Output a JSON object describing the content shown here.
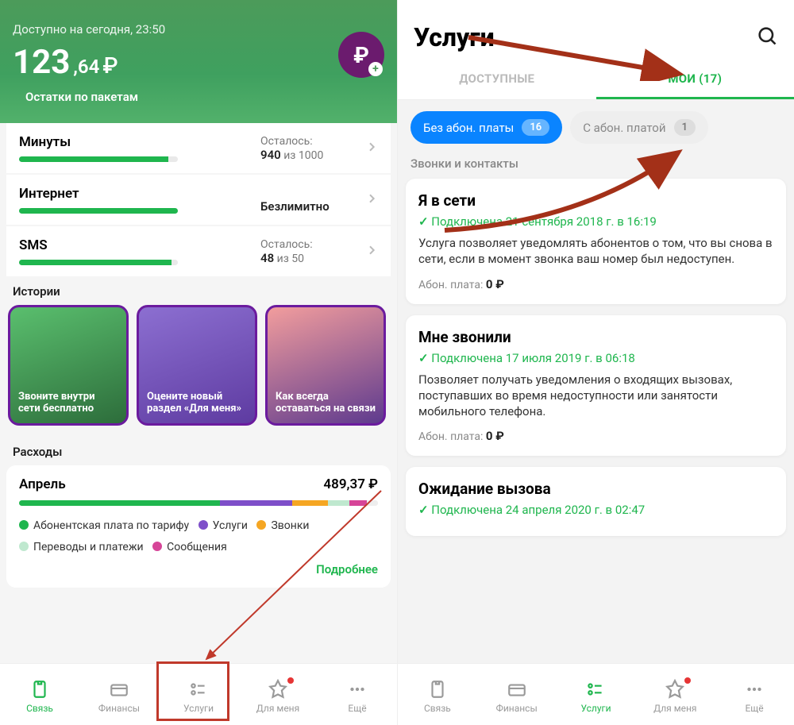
{
  "left": {
    "available_label": "Доступно на сегодня, 23:50",
    "balance_whole": "123",
    "balance_cents": ",64",
    "balance_cur": "₽",
    "packages_label": "Остатки по пакетам",
    "history_label": "Истории",
    "expenses_label": "Расходы",
    "pkgs": [
      {
        "t": "Минуты",
        "l": "Осталось:",
        "v": "940",
        "of": " из 1000",
        "pct": 94
      },
      {
        "t": "Интернет",
        "l": "",
        "v": "Безлимитно",
        "of": "",
        "pct": 100
      },
      {
        "t": "SMS",
        "l": "Осталось:",
        "v": "48",
        "of": " из 50",
        "pct": 96
      }
    ],
    "stories": [
      "Звоните внутри сети бесплатно",
      "Оцените новый раздел «Для меня»",
      "Как всегда оставаться на связи"
    ],
    "exp": {
      "month": "Апрель",
      "total": "489,37 ₽",
      "seg": [
        {
          "c": "#1fb64e",
          "w": 56
        },
        {
          "c": "#7e4fc9",
          "w": 20
        },
        {
          "c": "#f5a623",
          "w": 10
        },
        {
          "c": "#bfe8cf",
          "w": 6
        },
        {
          "c": "#d64598",
          "w": 5
        },
        {
          "c": "#eee",
          "w": 3
        }
      ],
      "legend1a": "Абонентская плата по тарифу",
      "legend1b": "Услуги",
      "legend1c": "Звонки",
      "legend2a": "Переводы и платежи",
      "legend2b": "Сообщения",
      "more": "Подробнее"
    },
    "tabs": [
      "Связь",
      "Финансы",
      "Услуги",
      "Для меня",
      "Ещё"
    ]
  },
  "right": {
    "title": "Услуги",
    "tabA": "ДОСТУПНЫЕ",
    "tabB": "МОИ (17)",
    "chipA": "Без абон. платы",
    "chipA_n": "16",
    "chipB": "С абон. платой",
    "chipB_n": "1",
    "section": "Звонки и контакты",
    "svcs": [
      {
        "t": "Я в сети",
        "s": "Подключена 21 сентября 2018 г. в 16:19",
        "d": "Услуга позволяет уведомлять абонентов о том, что вы снова в сети, если в момент звонка ваш номер был недоступен.",
        "fL": "Абон. плата:",
        "fV": "0 ₽"
      },
      {
        "t": "Мне звонили",
        "s": "Подключена 17 июля 2019 г. в 06:18",
        "d": "Позволяет получать уведомления о входящих вызовах, поступавших во время недоступности или занятости мобильного телефона.",
        "fL": "Абон. плата:",
        "fV": "0 ₽"
      },
      {
        "t": "Ожидание вызова",
        "s": "Подключена 24 апреля 2020 г. в 02:47",
        "d": "",
        "fL": "",
        "fV": ""
      }
    ],
    "tabs": [
      "Связь",
      "Финансы",
      "Услуги",
      "Для меня",
      "Ещё"
    ]
  }
}
